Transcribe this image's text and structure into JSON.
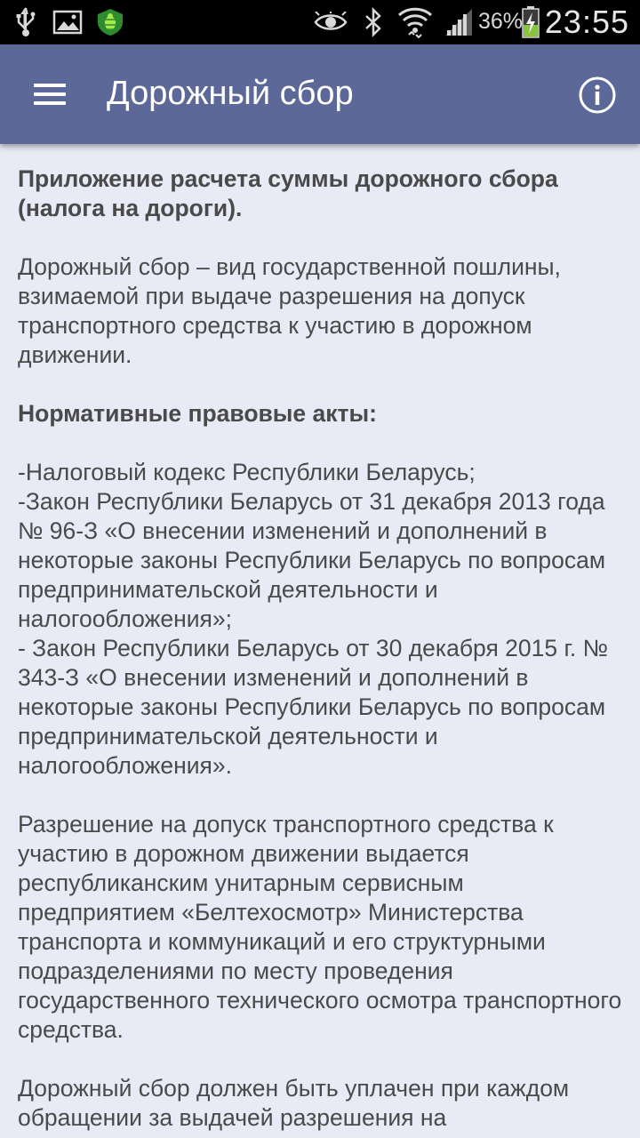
{
  "status_bar": {
    "battery_percent": "36%",
    "time": "23:55",
    "icons": [
      "usb-icon",
      "gallery-icon",
      "shield-bug-icon",
      "eye-icon",
      "bluetooth-icon",
      "wifi-icon",
      "signal-icon",
      "battery-charging-icon"
    ]
  },
  "app_bar": {
    "title": "Дорожный сбор",
    "menu_icon": "hamburger-menu-icon",
    "info_icon": "info-icon"
  },
  "content": {
    "heading": " Приложение расчета суммы дорожного сбора (налога на дороги).",
    "definition": " Дорожный сбор – вид государственной пошлины, взимаемой при выдаче разрешения на допуск транспортного средства к участию в дорожном движении.",
    "acts_heading": " Нормативные правовые акты:",
    "acts": [
      " -Налоговый кодекс Республики Беларусь;",
      " -Закон Республики Беларусь от 31 декабря 2013 года № 96-З «О внесении изменений и дополнений в некоторые законы Республики Беларусь по вопросам предпринимательской деятельности и налогообложения»;",
      " - Закон Республики Беларусь от 30 декабря 2015 г. № 343-З «О внесении изменений и дополнений в некоторые законы Республики Беларусь по вопросам предпринимательской деятельности и налогообложения»."
    ],
    "issuance": " Разрешение на допуск транспортного средства к участию в дорожном движении выдается республиканским унитарным сервисным предприятием «Белтехосмотр» Министерства транспорта и коммуникаций и его структурными подразделениями по месту проведения государственного технического осмотра транспортного средства.",
    "payment": " Дорожный сбор должен быть уплачен при каждом обращении за выдачей разрешения на"
  }
}
